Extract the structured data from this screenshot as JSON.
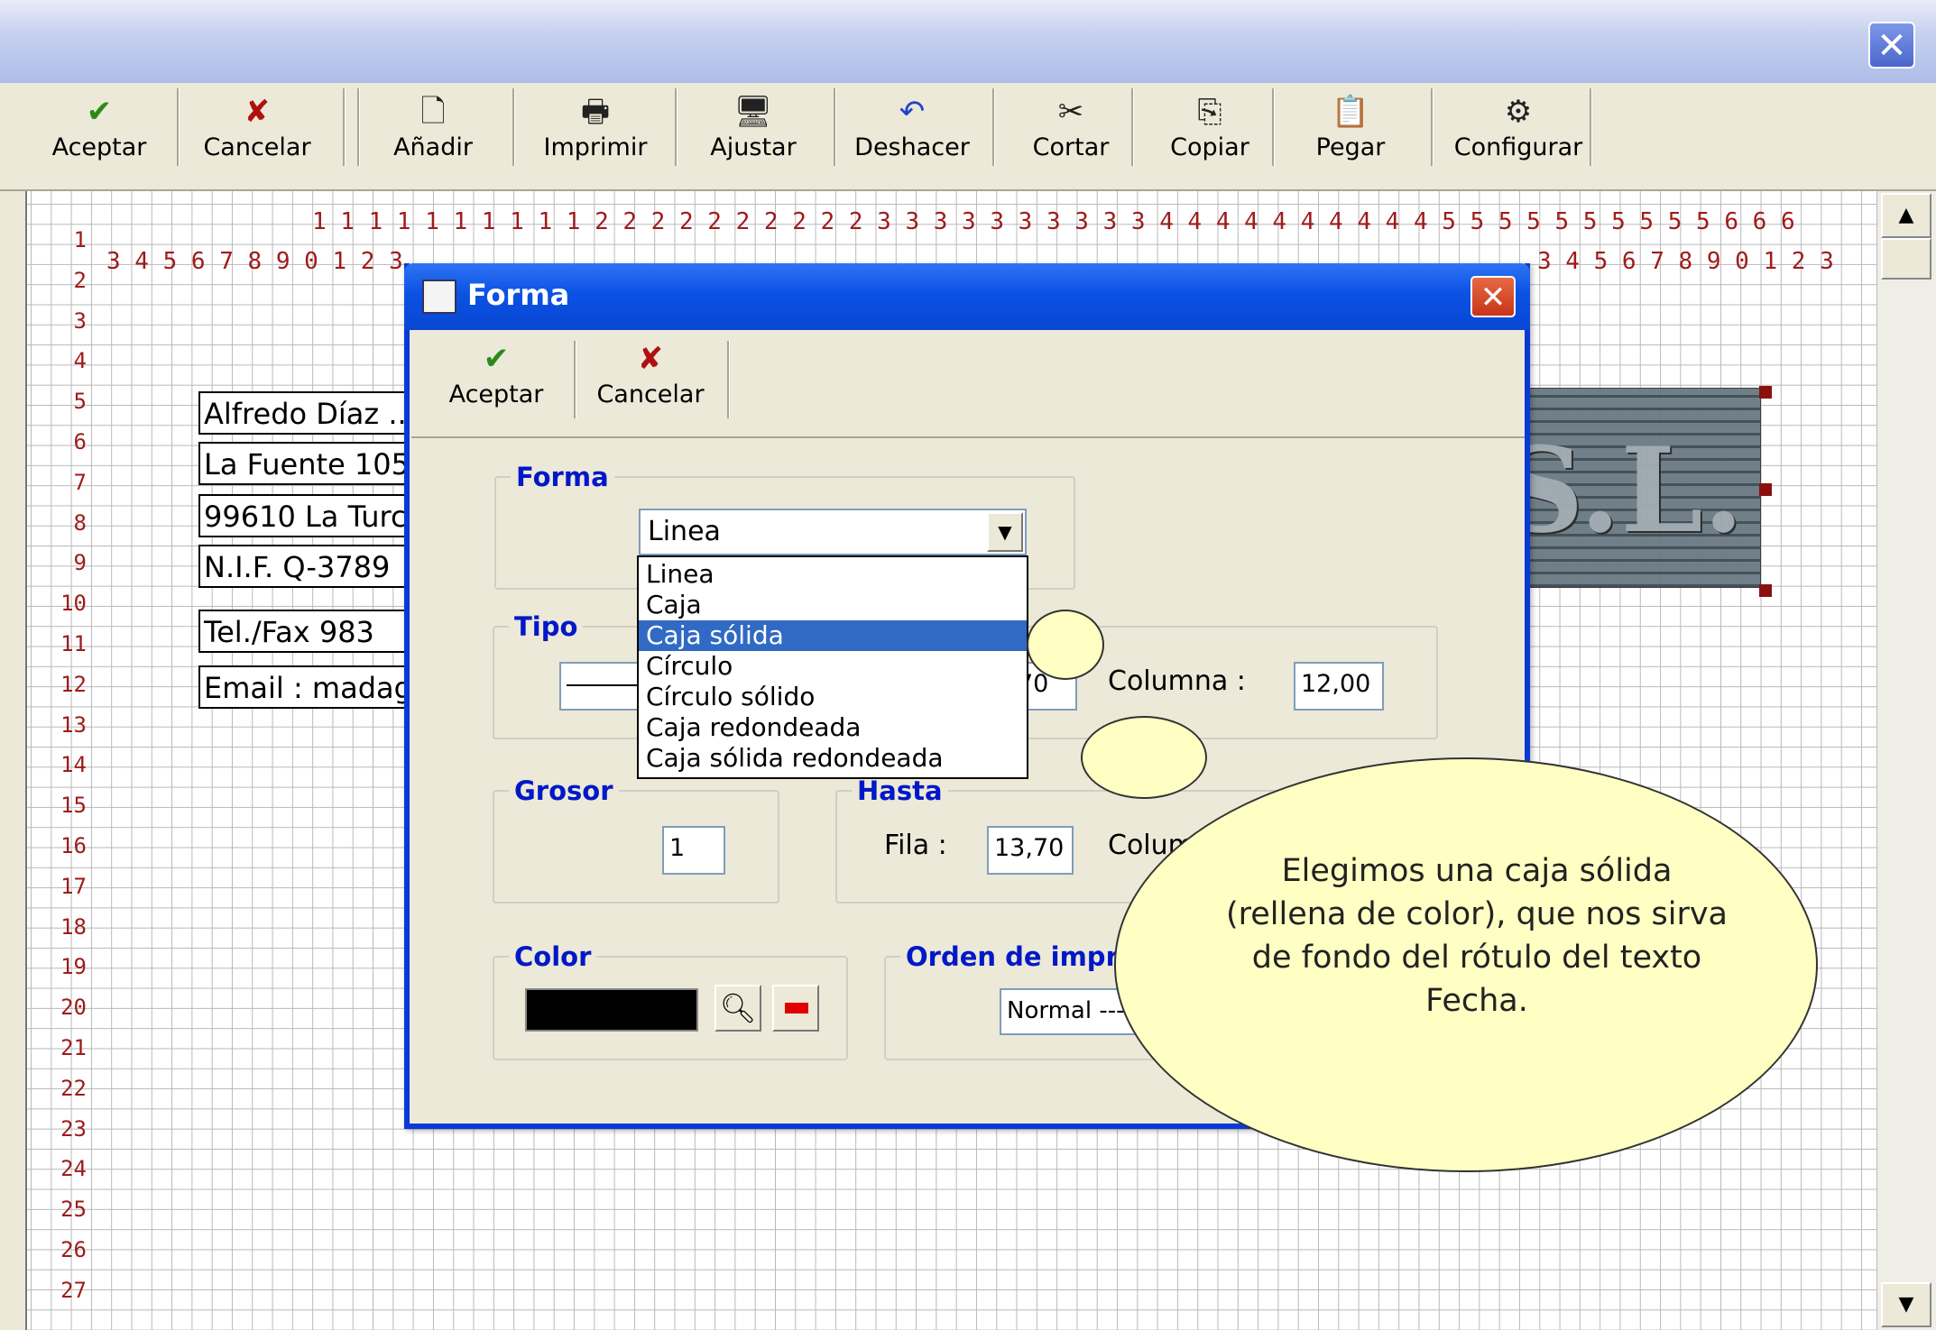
{
  "window": {
    "close_glyph": "✕"
  },
  "toolbar": {
    "items": [
      {
        "label": "Aceptar",
        "icon": "✔",
        "icon_color": "#2c8a1a"
      },
      {
        "label": "Cancelar",
        "icon": "✘",
        "icon_color": "#b01010"
      },
      {
        "label": "Añadir",
        "icon": "🗋",
        "icon_color": "#222222"
      },
      {
        "label": "Imprimir",
        "icon": "🖶",
        "icon_color": "#222222"
      },
      {
        "label": "Ajustar",
        "icon": "🖥",
        "icon_color": "#222222"
      },
      {
        "label": "Deshacer",
        "icon": "↶",
        "icon_color": "#2244cc"
      },
      {
        "label": "Cortar",
        "icon": "✂",
        "icon_color": "#222222"
      },
      {
        "label": "Copiar",
        "icon": "⎘",
        "icon_color": "#222222"
      },
      {
        "label": "Pegar",
        "icon": "📋",
        "icon_color": "#222222"
      },
      {
        "label": "Configurar",
        "icon": "⚙",
        "icon_color": "#222222"
      }
    ]
  },
  "ruler": {
    "top_tens": "1 1 1 1 1 1 1 1 1 1 2 2 2 2 2 2 2 2 2 2 3 3 3 3 3 3 3 3 3 3 4 4 4 4 4 4 4 4 4 4 5 5 5 5 5 5 5 5 5 5 6 6 6",
    "top_units_left": "3 4 5 6 7 8 9 0 1 2 3",
    "top_units_right": "3 4 5 6 7 8 9 0 1 2 3",
    "rows": [
      "1",
      "2",
      "3",
      "4",
      "5",
      "6",
      "7",
      "8",
      "9",
      "10",
      "11",
      "12",
      "13",
      "14",
      "15",
      "16",
      "17",
      "18",
      "19",
      "20",
      "21",
      "22",
      "23",
      "24",
      "25",
      "26",
      "27"
    ]
  },
  "report_fields": [
    "Alfredo Díaz ...",
    "La Fuente 105",
    "99610 La Turc",
    "N.I.F. Q-3789",
    "Tel./Fax 983",
    "Email : madago"
  ],
  "logo_text": "S.L.",
  "dialog": {
    "title": "Forma",
    "accept_label": "Aceptar",
    "cancel_label": "Cancelar",
    "accept_icon": "✔",
    "cancel_icon": "✘",
    "forma_group": "Forma",
    "combo_value": "Linea",
    "options": [
      "Linea",
      "Caja",
      "Caja sólida",
      "Círculo",
      "Círculo sólido",
      "Caja redondeada",
      "Caja sólida redondeada"
    ],
    "selected_option": "Caja sólida",
    "tipo_group": "Tipo",
    "desde_fila_partial": "70",
    "columna_label": "Columna :",
    "columna_value": "12,00",
    "grosor_group": "Grosor",
    "grosor_value": "1",
    "hasta_group": "Hasta",
    "fila_label": "Fila :",
    "fila_value": "13,70",
    "hasta_columna_partial": "Colum",
    "color_group": "Color",
    "color_value": "#000000",
    "orden_group": "Orden de impre",
    "orden_value": "Normal ---"
  },
  "callout": {
    "text": "Elegimos una caja sólida (rellena de color), que nos sirva de fondo del rótulo del texto Fecha."
  }
}
